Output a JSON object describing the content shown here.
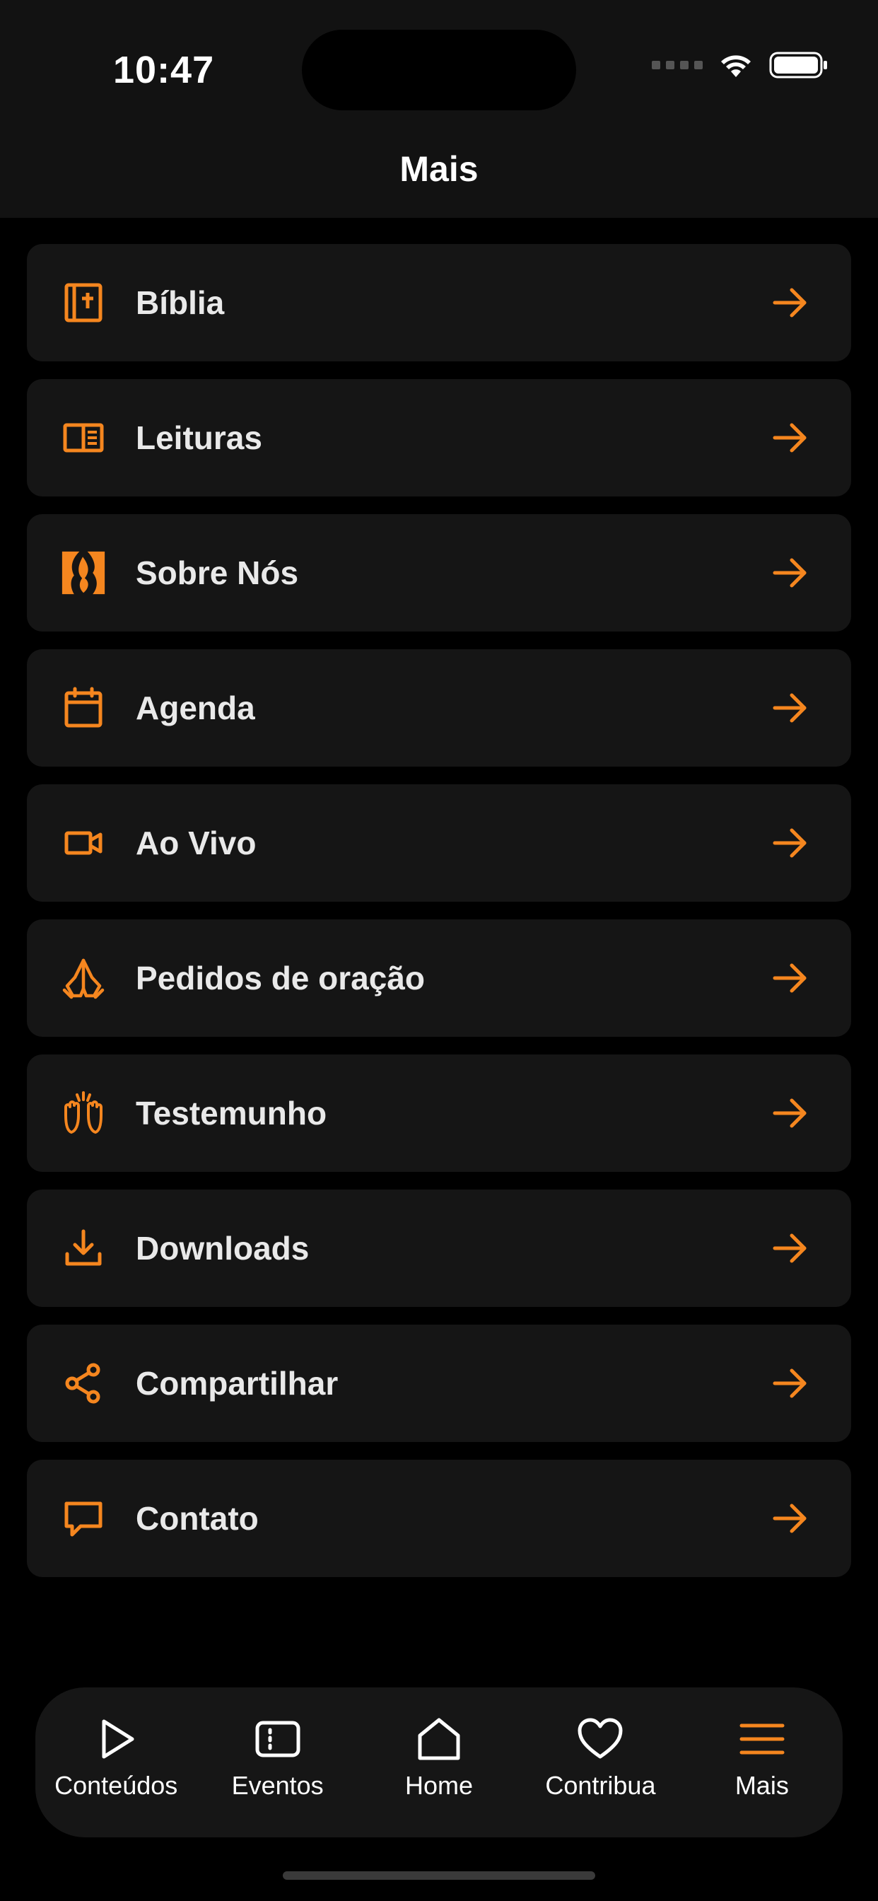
{
  "status": {
    "time": "10:47"
  },
  "header": {
    "title": "Mais"
  },
  "menu": {
    "items": [
      {
        "label": "Bíblia",
        "icon": "bible-icon"
      },
      {
        "label": "Leituras",
        "icon": "book-open-icon"
      },
      {
        "label": "Sobre Nós",
        "icon": "church-logo-icon"
      },
      {
        "label": "Agenda",
        "icon": "calendar-icon"
      },
      {
        "label": "Ao Vivo",
        "icon": "video-camera-icon"
      },
      {
        "label": "Pedidos de oração",
        "icon": "praying-hands-icon"
      },
      {
        "label": "Testemunho",
        "icon": "raised-hands-icon"
      },
      {
        "label": "Downloads",
        "icon": "download-icon"
      },
      {
        "label": "Compartilhar",
        "icon": "share-icon"
      },
      {
        "label": "Contato",
        "icon": "chat-bubble-icon"
      }
    ]
  },
  "tabbar": {
    "tabs": [
      {
        "label": "Conteúdos",
        "icon": "play-icon"
      },
      {
        "label": "Eventos",
        "icon": "ticket-icon"
      },
      {
        "label": "Home",
        "icon": "home-icon"
      },
      {
        "label": "Contribua",
        "icon": "heart-icon"
      },
      {
        "label": "Mais",
        "icon": "menu-icon"
      }
    ],
    "active": "Mais"
  },
  "colors": {
    "accent": "#F5861F",
    "background": "#000000",
    "card": "#151515",
    "bar": "#121212"
  }
}
